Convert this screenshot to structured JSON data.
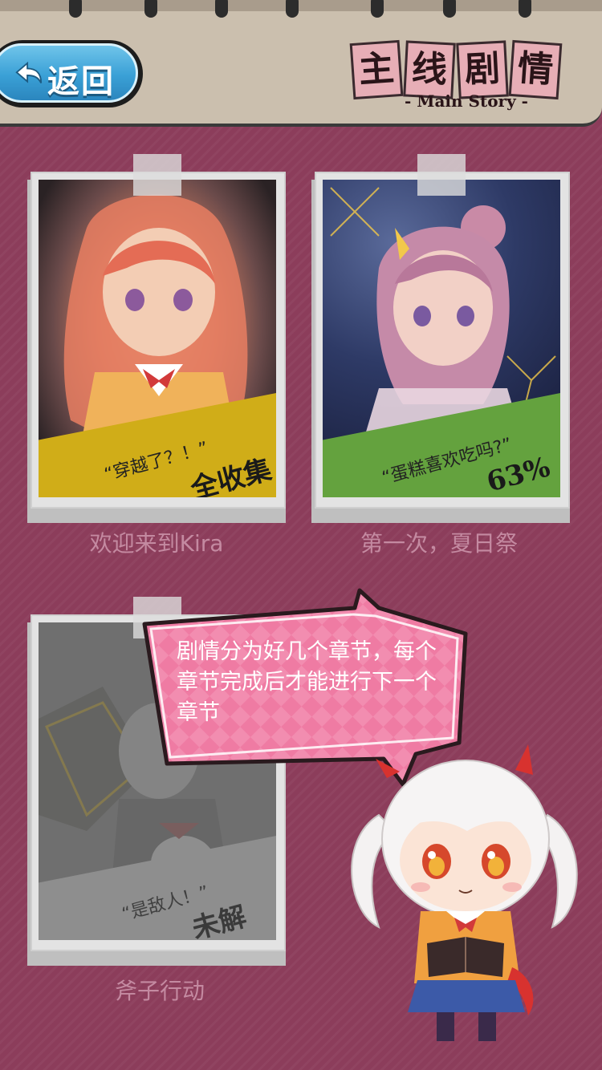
{
  "header": {
    "back_label": "返回",
    "title_chars": [
      "主",
      "线",
      "剧",
      "情"
    ],
    "subtitle": "- Main Story -"
  },
  "chapters": [
    {
      "quote": "“穿越了？！”",
      "status": "全收集",
      "title": "欢迎来到Kira",
      "band_color": "#d0ad18",
      "state": "complete"
    },
    {
      "quote": "“蛋糕喜欢吃吗?”",
      "status": "63%",
      "progress_percent": 63,
      "title": "第一次，夏日祭",
      "band_color": "#64a23e",
      "state": "in_progress"
    },
    {
      "quote": "“是敌人！”",
      "status": "未解锁",
      "title": "斧子行动",
      "band_color": "#9a9a9a",
      "state": "locked"
    }
  ],
  "tutorial": {
    "text": "剧情分为好几个章节，每个章节完成后才能进行下一个章节"
  },
  "colors": {
    "background": "#8c3d5b",
    "caption": "#c48aa1",
    "bubble": "#ef7ba3",
    "back_button": "#3aa0d6"
  }
}
